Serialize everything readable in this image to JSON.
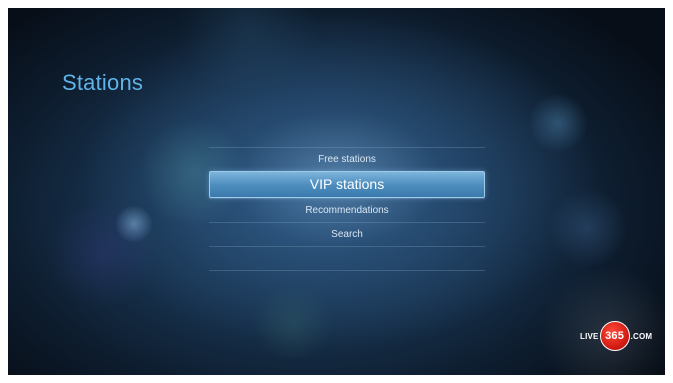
{
  "screen": {
    "title": "Stations"
  },
  "menu": {
    "items": [
      {
        "label": "Free stations",
        "selected": false
      },
      {
        "label": "VIP stations",
        "selected": true
      },
      {
        "label": "Recommendations",
        "selected": false
      },
      {
        "label": "Search",
        "selected": false
      }
    ]
  },
  "logo": {
    "prefix": "LIVE",
    "number": "365",
    "suffix": ".COM"
  },
  "colors": {
    "accent": "#5fb3e8",
    "selection": "#4f8fc0",
    "logo_red": "#d41e16"
  }
}
